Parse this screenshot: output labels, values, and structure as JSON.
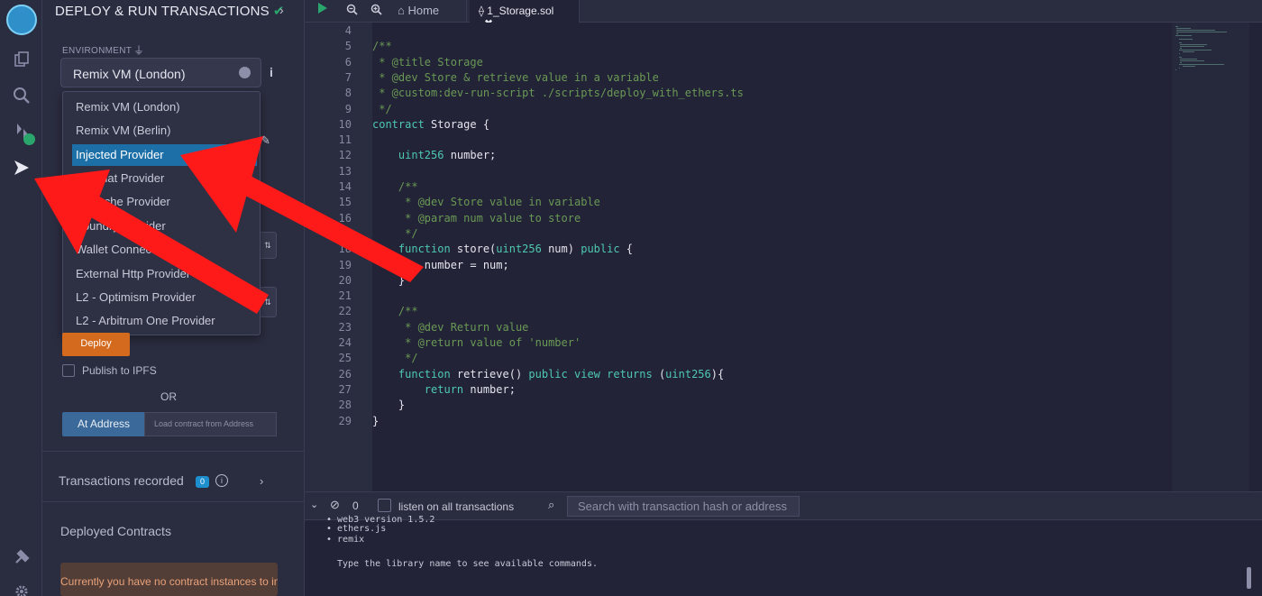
{
  "panel": {
    "title": "DEPLOY & RUN TRANSACTIONS",
    "environment_label": "ENVIRONMENT",
    "environment_value": "Remix VM (London)",
    "environment_options": [
      "Remix VM (London)",
      "Remix VM (Berlin)",
      "Injected Provider",
      "Hardhat Provider",
      "Ganache Provider",
      "Foundry Provider",
      "Wallet Connect",
      "External Http Provider",
      "L2 - Optimism Provider",
      "L2 - Arbitrum One Provider"
    ],
    "selected_option": "Injected Provider",
    "deploy_label": "Deploy",
    "publish_ipfs_label": "Publish to IPFS",
    "or_label": "OR",
    "at_address_label": "At Address",
    "load_contract_placeholder": "Load contract from Address",
    "transactions_recorded_label": "Transactions recorded",
    "transactions_count": "0",
    "deployed_contracts_label": "Deployed Contracts",
    "no_contract_text": "Currently you have no contract instances to interact with."
  },
  "tabs": {
    "home_label": "Home",
    "file_label": "1_Storage.sol"
  },
  "editor": {
    "lines": [
      {
        "n": "4",
        "t": ""
      },
      {
        "n": "5",
        "t": "/**"
      },
      {
        "n": "6",
        "t": " * @title Storage"
      },
      {
        "n": "7",
        "t": " * @dev Store & retrieve value in a variable"
      },
      {
        "n": "8",
        "t": " * @custom:dev-run-script ./scripts/deploy_with_ethers.ts"
      },
      {
        "n": "9",
        "t": " */"
      },
      {
        "n": "10",
        "t": "contract Storage {"
      },
      {
        "n": "11",
        "t": ""
      },
      {
        "n": "12",
        "t": "    uint256 number;"
      },
      {
        "n": "13",
        "t": ""
      },
      {
        "n": "14",
        "t": "    /**"
      },
      {
        "n": "15",
        "t": "     * @dev Store value in variable"
      },
      {
        "n": "16",
        "t": "     * @param num value to store"
      },
      {
        "n": "17",
        "t": "     */"
      },
      {
        "n": "18",
        "t": "    function store(uint256 num) public {"
      },
      {
        "n": "19",
        "t": "        number = num;"
      },
      {
        "n": "20",
        "t": "    }"
      },
      {
        "n": "21",
        "t": ""
      },
      {
        "n": "22",
        "t": "    /**"
      },
      {
        "n": "23",
        "t": "     * @dev Return value"
      },
      {
        "n": "24",
        "t": "     * @return value of 'number'"
      },
      {
        "n": "25",
        "t": "     */"
      },
      {
        "n": "26",
        "t": "    function retrieve() public view returns (uint256){"
      },
      {
        "n": "27",
        "t": "        return number;"
      },
      {
        "n": "28",
        "t": "    }"
      },
      {
        "n": "29",
        "t": "}"
      }
    ]
  },
  "terminal": {
    "pending_count": "0",
    "listen_label": "listen on all transactions",
    "search_placeholder": "Search with transaction hash or address",
    "lines": [
      "• web3 version 1.5.2",
      "• ethers.js",
      "• remix",
      "",
      "Type the library name to see available commands."
    ]
  },
  "colors": {
    "accent": "#1d6fa8",
    "deploy": "#d46a1e",
    "success": "#2aa66d",
    "arrow": "#ff1a1a"
  }
}
